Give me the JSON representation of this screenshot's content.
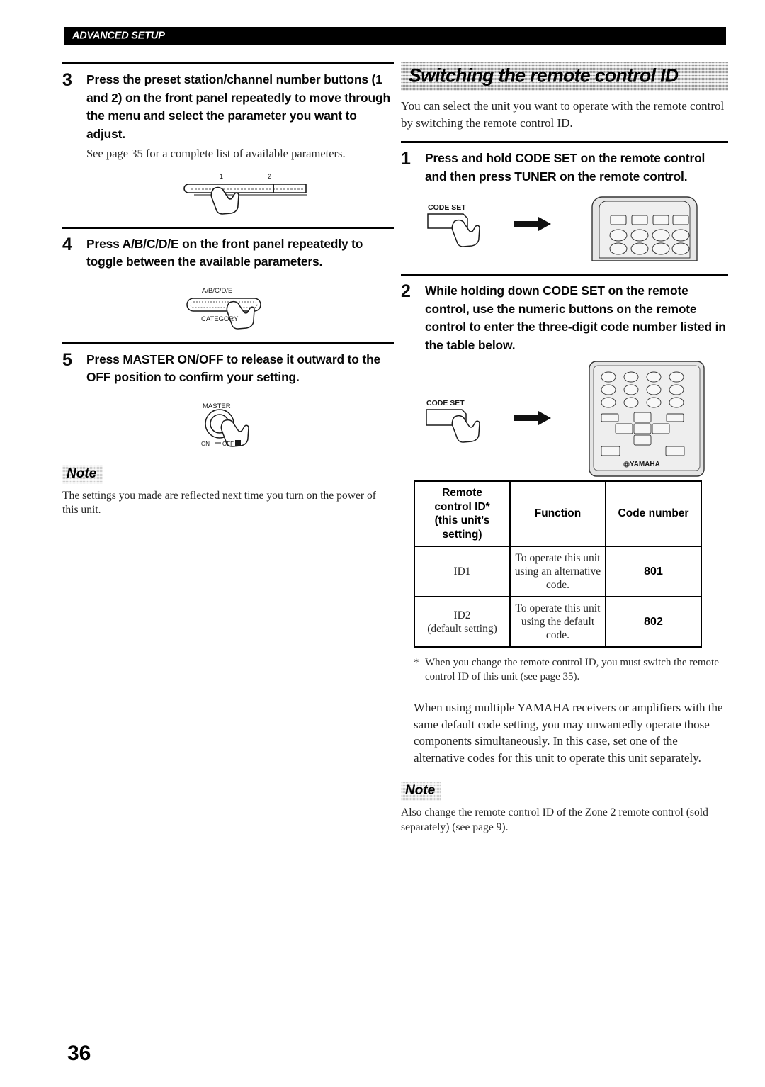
{
  "header": {
    "running_title": "ADVANCED SETUP"
  },
  "page_number": "36",
  "left_column": {
    "step3": {
      "number": "3",
      "heading": "Press the preset station/channel number buttons (1 and 2) on the front panel repeatedly to move through the menu and select the parameter you want to adjust.",
      "subtext": "See page 35 for a complete list of available parameters.",
      "illustration": {
        "name": "front-panel-preset-buttons",
        "label_1": "1",
        "label_2": "2"
      }
    },
    "step4": {
      "number": "4",
      "heading": "Press A/B/C/D/E on the front panel repeatedly to toggle between the available parameters.",
      "illustration": {
        "name": "front-panel-abcde-button",
        "top_label": "A/B/C/D/E",
        "bottom_label": "CATEGORY"
      }
    },
    "step5": {
      "number": "5",
      "heading": "Press MASTER ON/OFF to release it outward to the OFF position to confirm your setting.",
      "illustration": {
        "name": "master-on-off-switch",
        "top_label": "MASTER",
        "on_label": "ON",
        "off_label": "OFF"
      }
    },
    "note": {
      "badge": "Note",
      "text": "The settings you made are reflected next time you turn on the power of this unit."
    }
  },
  "right_column": {
    "section_title": "Switching the remote control ID",
    "intro": "You can select the unit you want to operate with the remote control by switching the remote control ID.",
    "step1": {
      "number": "1",
      "heading": "Press and hold CODE SET on the remote control and then press TUNER on the remote control.",
      "illustration": {
        "name": "code-set-then-tuner",
        "button_label": "CODE SET"
      }
    },
    "step2": {
      "number": "2",
      "heading": "While holding down CODE SET on the remote control, use the numeric buttons on the remote control to enter the three-digit code number listed in the table below.",
      "illustration": {
        "name": "code-set-then-numeric-buttons",
        "button_label": "CODE SET",
        "brand_label": "YAMAHA"
      }
    },
    "table": {
      "headers": [
        "Remote control ID* (this unit’s setting)",
        "Function",
        "Code number"
      ],
      "header_lines": {
        "col1": [
          "Remote",
          "control ID*",
          "(this unit’s",
          "setting)"
        ],
        "col2": "Function",
        "col3": "Code number"
      },
      "rows": [
        {
          "id": "ID1",
          "id_sub": "",
          "function": "To operate this unit using an alternative code.",
          "code": "801"
        },
        {
          "id": "ID2",
          "id_sub": "(default setting)",
          "function": "To operate this unit using the default code.",
          "code": "802"
        }
      ]
    },
    "footnote": {
      "marker": "*",
      "text": "When you change the remote control ID, you must switch the remote control ID of this unit (see page 35)."
    },
    "paragraph": "When using multiple YAMAHA receivers or amplifiers with the same default code setting, you may unwantedly operate those components simultaneously. In this case, set one of the alternative codes for this unit to operate this unit separately.",
    "note": {
      "badge": "Note",
      "text": "Also change the remote control ID of the Zone 2 remote control (sold separately) (see page 9)."
    }
  }
}
